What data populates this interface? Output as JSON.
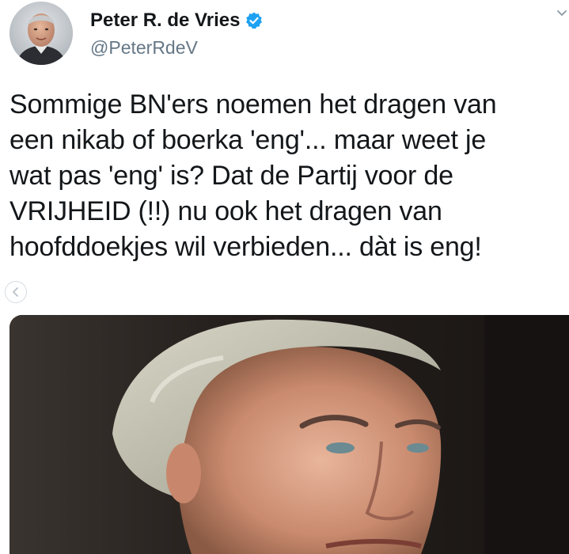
{
  "author": {
    "display_name": "Peter R. de Vries",
    "handle": "@PeterRdeV",
    "verified": true,
    "verified_color": "#1da1f2"
  },
  "tweet": {
    "lines": [
      "Sommige BN'ers noemen het dragen van",
      "een nikab of  boerka 'eng'... maar weet je",
      "wat pas 'eng' is? Dat de Partij voor de",
      "VRIJHEID (!!) nu ook het dragen van",
      "hoofddoekjes wil verbieden... dàt is eng!"
    ]
  },
  "icons": {
    "avatar": "profile-photo",
    "verified": "verified-badge-icon",
    "menu": "chevron-down-icon",
    "back": "chevron-left-icon",
    "media": "photo-of-man-with-grey-hair"
  },
  "colors": {
    "text": "#14171a",
    "secondary": "#657786"
  }
}
